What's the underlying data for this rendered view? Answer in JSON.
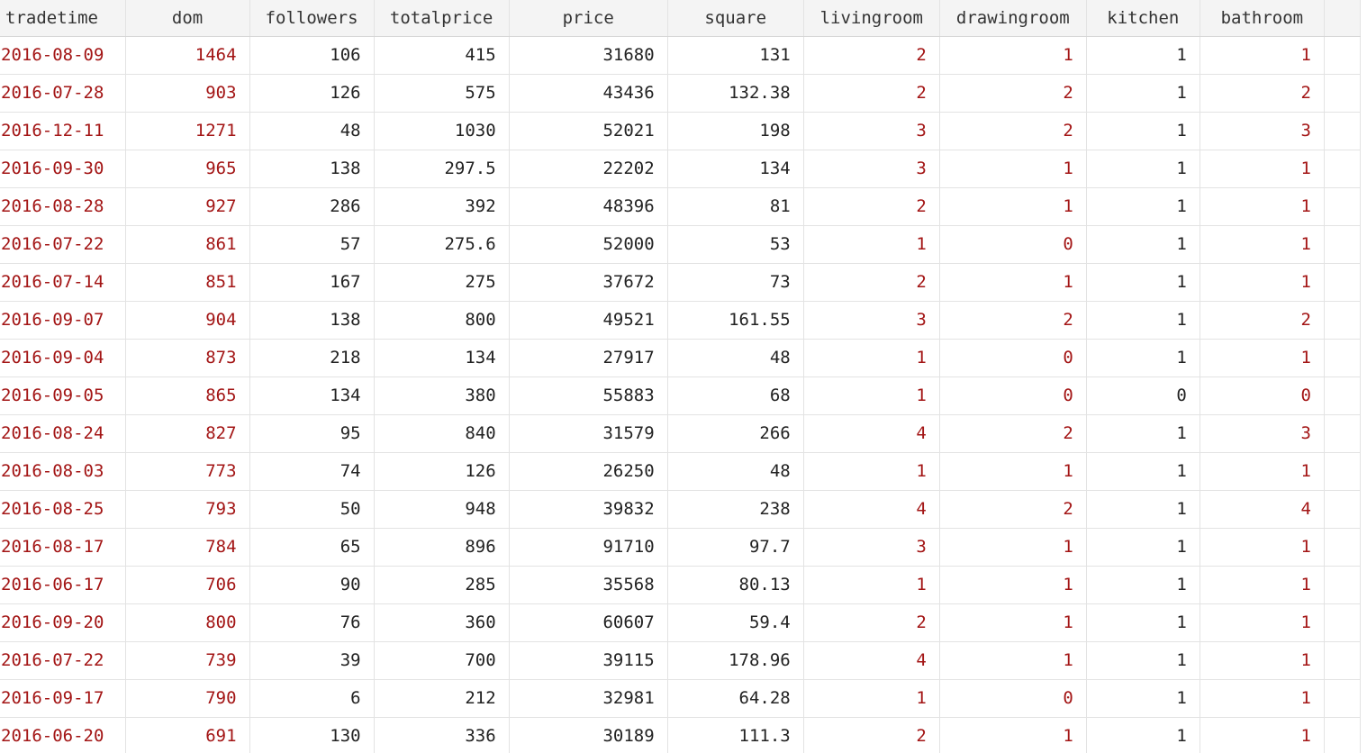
{
  "columns": [
    {
      "key": "tradetime",
      "label": "tradetime"
    },
    {
      "key": "dom",
      "label": "dom"
    },
    {
      "key": "followers",
      "label": "followers"
    },
    {
      "key": "totalprice",
      "label": "totalprice"
    },
    {
      "key": "price",
      "label": "price"
    },
    {
      "key": "square",
      "label": "square"
    },
    {
      "key": "livingroom",
      "label": "livingroom"
    },
    {
      "key": "drawingroom",
      "label": "drawingroom"
    },
    {
      "key": "kitchen",
      "label": "kitchen"
    },
    {
      "key": "bathroom",
      "label": "bathroom"
    }
  ],
  "rows": [
    [
      "2016-08-09",
      "1464",
      "106",
      "415",
      "31680",
      "131",
      "2",
      "1",
      "1",
      "1"
    ],
    [
      "2016-07-28",
      "903",
      "126",
      "575",
      "43436",
      "132.38",
      "2",
      "2",
      "1",
      "2"
    ],
    [
      "2016-12-11",
      "1271",
      "48",
      "1030",
      "52021",
      "198",
      "3",
      "2",
      "1",
      "3"
    ],
    [
      "2016-09-30",
      "965",
      "138",
      "297.5",
      "22202",
      "134",
      "3",
      "1",
      "1",
      "1"
    ],
    [
      "2016-08-28",
      "927",
      "286",
      "392",
      "48396",
      "81",
      "2",
      "1",
      "1",
      "1"
    ],
    [
      "2016-07-22",
      "861",
      "57",
      "275.6",
      "52000",
      "53",
      "1",
      "0",
      "1",
      "1"
    ],
    [
      "2016-07-14",
      "851",
      "167",
      "275",
      "37672",
      "73",
      "2",
      "1",
      "1",
      "1"
    ],
    [
      "2016-09-07",
      "904",
      "138",
      "800",
      "49521",
      "161.55",
      "3",
      "2",
      "1",
      "2"
    ],
    [
      "2016-09-04",
      "873",
      "218",
      "134",
      "27917",
      "48",
      "1",
      "0",
      "1",
      "1"
    ],
    [
      "2016-09-05",
      "865",
      "134",
      "380",
      "55883",
      "68",
      "1",
      "0",
      "0",
      "0"
    ],
    [
      "2016-08-24",
      "827",
      "95",
      "840",
      "31579",
      "266",
      "4",
      "2",
      "1",
      "3"
    ],
    [
      "2016-08-03",
      "773",
      "74",
      "126",
      "26250",
      "48",
      "1",
      "1",
      "1",
      "1"
    ],
    [
      "2016-08-25",
      "793",
      "50",
      "948",
      "39832",
      "238",
      "4",
      "2",
      "1",
      "4"
    ],
    [
      "2016-08-17",
      "784",
      "65",
      "896",
      "91710",
      "97.7",
      "3",
      "1",
      "1",
      "1"
    ],
    [
      "2016-06-17",
      "706",
      "90",
      "285",
      "35568",
      "80.13",
      "1",
      "1",
      "1",
      "1"
    ],
    [
      "2016-09-20",
      "800",
      "76",
      "360",
      "60607",
      "59.4",
      "2",
      "1",
      "1",
      "1"
    ],
    [
      "2016-07-22",
      "739",
      "39",
      "700",
      "39115",
      "178.96",
      "4",
      "1",
      "1",
      "1"
    ],
    [
      "2016-09-17",
      "790",
      "6",
      "212",
      "32981",
      "64.28",
      "1",
      "0",
      "1",
      "1"
    ],
    [
      "2016-06-20",
      "691",
      "130",
      "336",
      "30189",
      "111.3",
      "2",
      "1",
      "1",
      "1"
    ]
  ]
}
